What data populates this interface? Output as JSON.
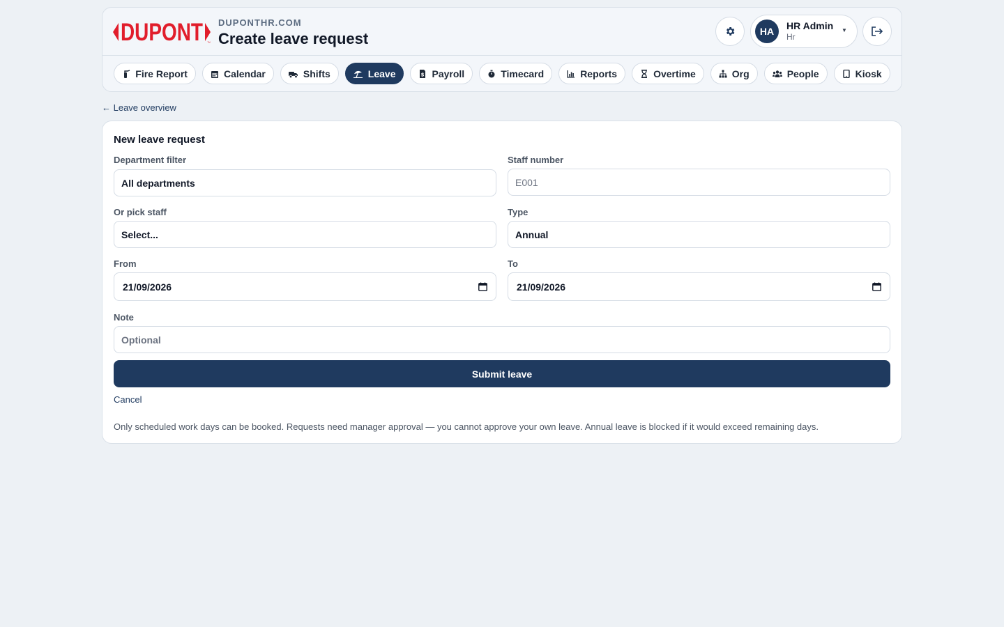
{
  "brand": {
    "logo_text": "DUPONT",
    "domain": "DUPONTHR.COM",
    "logo_color": "#e11d2b"
  },
  "header": {
    "title": "Create leave request"
  },
  "user": {
    "initials": "HA",
    "name": "HR Admin",
    "role": "Hr"
  },
  "nav": [
    {
      "label": "Fire Report",
      "icon": "fire-extinguisher-icon"
    },
    {
      "label": "Calendar",
      "icon": "calendar-icon"
    },
    {
      "label": "Shifts",
      "icon": "truck-icon"
    },
    {
      "label": "Leave",
      "icon": "umbrella-beach-icon",
      "active": true
    },
    {
      "label": "Payroll",
      "icon": "invoice-icon"
    },
    {
      "label": "Timecard",
      "icon": "stopwatch-icon"
    },
    {
      "label": "Reports",
      "icon": "bar-chart-icon"
    },
    {
      "label": "Overtime",
      "icon": "hourglass-icon"
    },
    {
      "label": "Org",
      "icon": "sitemap-icon"
    },
    {
      "label": "People",
      "icon": "users-icon"
    },
    {
      "label": "Kiosk",
      "icon": "tablet-icon"
    }
  ],
  "back_link": "← Leave overview",
  "form": {
    "title": "New leave request",
    "department_label": "Department filter",
    "department_value": "All departments",
    "staff_number_label": "Staff number",
    "staff_number_placeholder": "E001",
    "pick_staff_label": "Or pick staff",
    "pick_staff_value": "Select...",
    "type_label": "Type",
    "type_value": "Annual",
    "from_label": "From",
    "from_value": "21/09/2026",
    "to_label": "To",
    "to_value": "21/09/2026",
    "note_label": "Note",
    "note_placeholder": "Optional",
    "submit_label": "Submit leave",
    "cancel_label": "Cancel",
    "help_text": "Only scheduled work days can be booked. Requests need manager approval — you cannot approve your own leave. Annual leave is blocked if it would exceed remaining days."
  },
  "colors": {
    "primary": "#1f3a5f",
    "background": "#edf1f5"
  }
}
